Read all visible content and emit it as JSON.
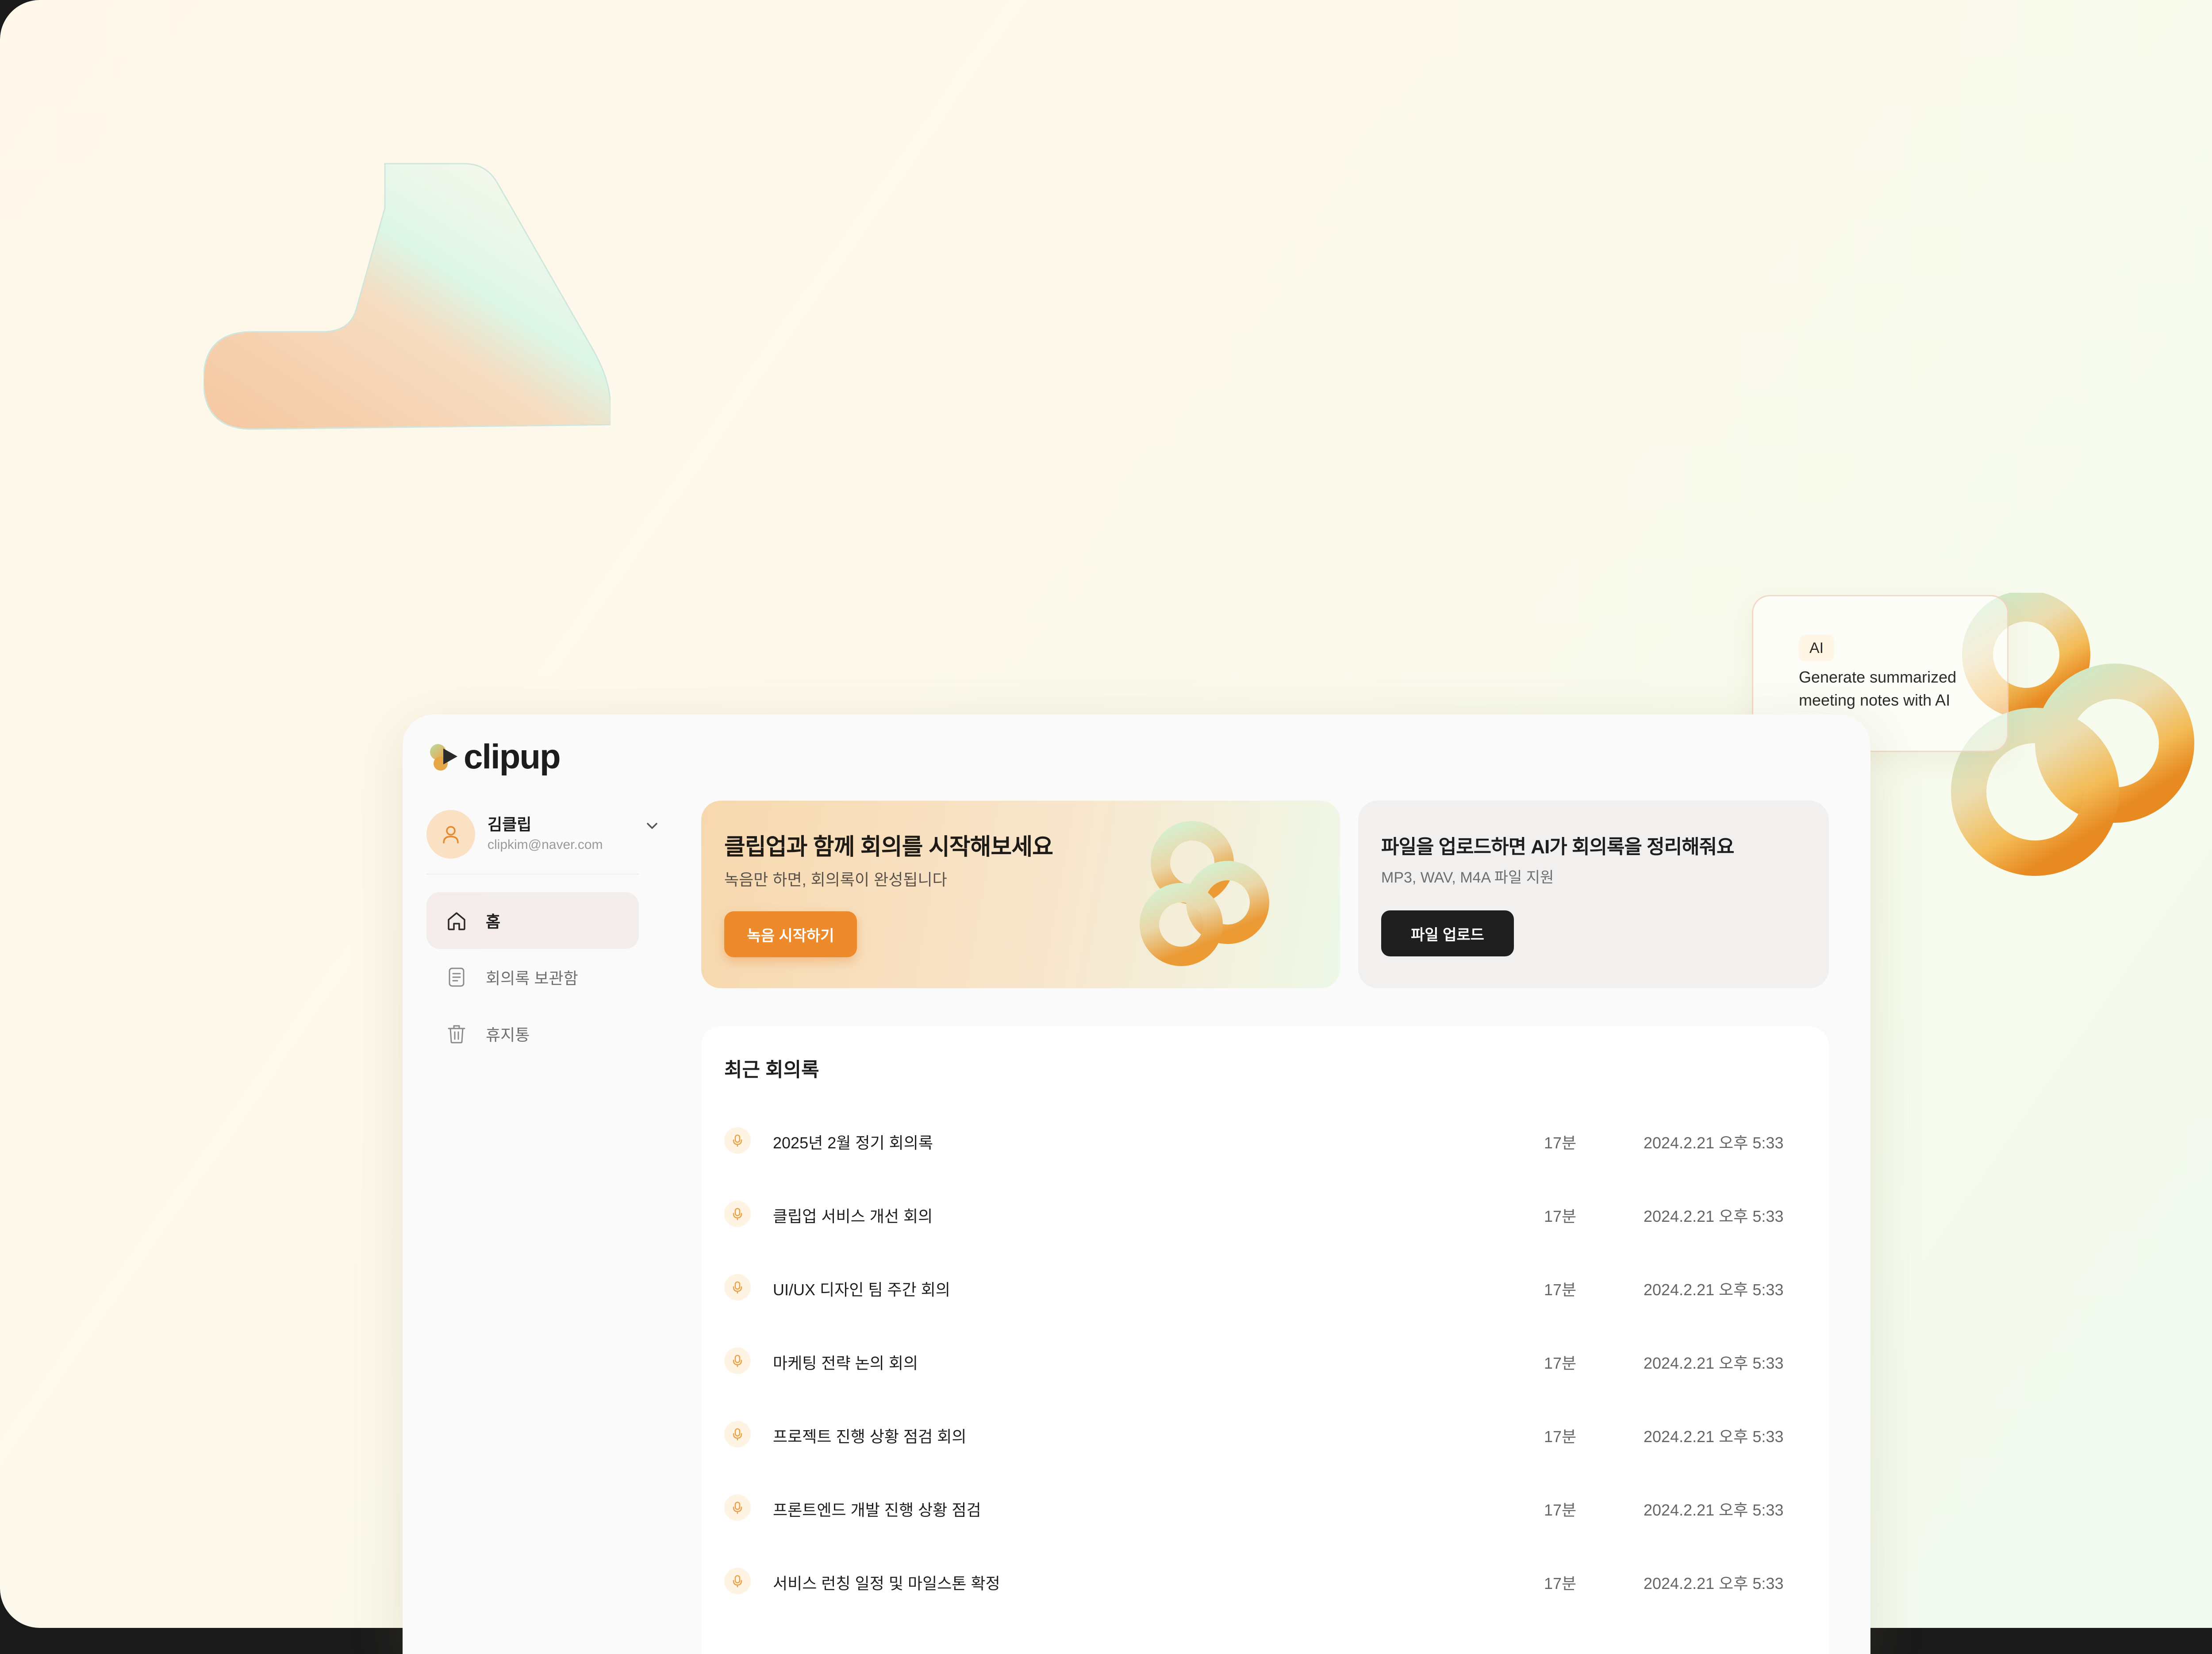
{
  "brand": {
    "name": "clipup"
  },
  "promo_card": {
    "badge": "AI",
    "text": "Generate summarized meeting notes with AI"
  },
  "user": {
    "name": "김클립",
    "email": "clipkim@naver.com"
  },
  "nav": [
    {
      "label": "홈",
      "icon": "home-icon",
      "active": true
    },
    {
      "label": "회의록 보관함",
      "icon": "archive-icon",
      "active": false
    },
    {
      "label": "휴지통",
      "icon": "trash-icon",
      "active": false
    }
  ],
  "hero": {
    "title": "클립업과 함께 회의를 시작해보세요",
    "subtitle": "녹음만 하면, 회의록이 완성됩니다",
    "button": "녹음 시작하기"
  },
  "upload": {
    "title": "파일을 업로드하면 AI가 회의록을 정리해줘요",
    "subtitle": "MP3, WAV, M4A 파일 지원",
    "button": "파일 업로드"
  },
  "recent": {
    "title": "최근 회의록",
    "items": [
      {
        "title": "2025년 2월 정기 회의록",
        "duration": "17분",
        "date": "2024.2.21 오후 5:33"
      },
      {
        "title": "클립업 서비스 개선 회의",
        "duration": "17분",
        "date": "2024.2.21 오후 5:33"
      },
      {
        "title": "UI/UX 디자인 팀 주간 회의",
        "duration": "17분",
        "date": "2024.2.21 오후 5:33"
      },
      {
        "title": "마케팅 전략 논의 회의",
        "duration": "17분",
        "date": "2024.2.21 오후 5:33"
      },
      {
        "title": "프로젝트 진행 상황 점검 회의",
        "duration": "17분",
        "date": "2024.2.21 오후 5:33"
      },
      {
        "title": "프론트엔드 개발 진행 상황 점검",
        "duration": "17분",
        "date": "2024.2.21 오후 5:33"
      },
      {
        "title": "서비스 런칭 일정 및 마일스톤 확정",
        "duration": "17분",
        "date": "2024.2.21 오후 5:33"
      }
    ]
  },
  "colors": {
    "accent": "#ec8a2c",
    "dark_button": "#1f1f1f"
  }
}
